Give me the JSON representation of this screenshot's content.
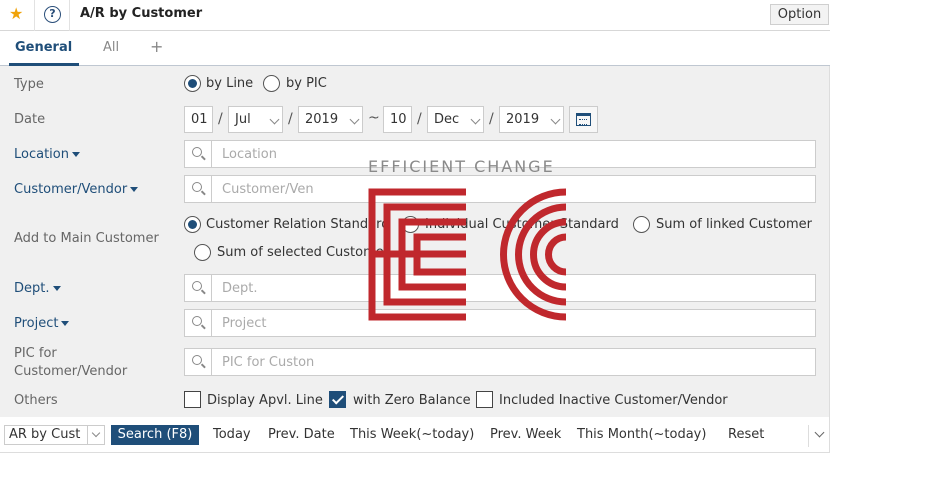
{
  "header": {
    "title": "A/R by Customer",
    "option_label": "Option",
    "star_icon": "star-icon",
    "help_icon": "help-icon",
    "help_glyph": "?"
  },
  "tabs": {
    "general": "General",
    "all": "All",
    "add": "+"
  },
  "form": {
    "type": {
      "label": "Type",
      "options": [
        "by Line",
        "by PIC"
      ],
      "selected": "by Line"
    },
    "date": {
      "label": "Date",
      "from": {
        "day": "01",
        "month": "Jul",
        "year": "2019"
      },
      "to": {
        "day": "10",
        "month": "Dec",
        "year": "2019"
      },
      "separator": "~",
      "slash": "/"
    },
    "location": {
      "label": "Location",
      "placeholder": "Location"
    },
    "customer_vendor": {
      "label": "Customer/Vendor",
      "placeholder": "Customer/Ven"
    },
    "add_to_main_customer": {
      "label": "Add to Main Customer",
      "options": [
        "Customer Relation Standard",
        "Individual Customer Standard",
        "Sum of linked Customer",
        "Sum of selected Customer"
      ],
      "selected": "Customer Relation Standard"
    },
    "dept": {
      "label": "Dept.",
      "placeholder": "Dept."
    },
    "project": {
      "label": "Project",
      "placeholder": "Project"
    },
    "pic": {
      "label_line1": "PIC for",
      "label_line2": "Customer/Vendor",
      "placeholder": "PIC for Custon"
    },
    "others": {
      "label": "Others",
      "display_apvl_line": {
        "label": "Display Apvl. Line",
        "checked": false
      },
      "with_zero_balance": {
        "label": "with Zero Balance",
        "checked": true
      },
      "included_inactive": {
        "label": "Included Inactive Customer/Vendor",
        "checked": false
      }
    }
  },
  "footer": {
    "select_value": "AR by Cust",
    "search_label": "Search (F8)",
    "links": [
      "Today",
      "Prev. Date",
      "This Week(~today)",
      "Prev. Week",
      "This Month(~today)",
      "Reset"
    ]
  },
  "watermark": {
    "text": "EFFICIENT CHANGE",
    "color": "#c0282d"
  },
  "colors": {
    "accent": "#1f4e79",
    "star": "#f0a30a",
    "form_bg": "#f0f0f0"
  }
}
